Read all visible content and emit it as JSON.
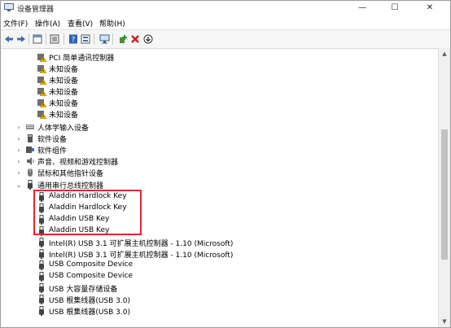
{
  "window": {
    "title": "设备管理器",
    "controls": {
      "minimize": "—",
      "maximize": "☐",
      "close": "✕"
    }
  },
  "menu": [
    "文件(F)",
    "操作(A)",
    "查看(V)",
    "帮助(H)"
  ],
  "toolbar": [
    "back-icon",
    "forward-icon",
    "properties-icon",
    "view-icon",
    "help-icon",
    "details-icon",
    "monitor-icon",
    "add-driver-icon",
    "uninstall-icon",
    "download-icon"
  ],
  "tree": {
    "unknown_group": [
      "PCI 简单通讯控制器",
      "未知设备",
      "未知设备",
      "未知设备",
      "未知设备",
      "未知设备"
    ],
    "categories": [
      "人体学输入设备",
      "软件设备",
      "软件组件",
      "声音、视频和游戏控制器",
      "鼠标和其他指针设备",
      "通用串行总线控制器"
    ],
    "usb_devices": [
      "Aladdin Hardlock Key",
      "Aladdin Hardlock Key",
      "Aladdin USB Key",
      "Aladdin USB Key",
      "Intel(R) USB 3.1 可扩展主机控制器 - 1.10 (Microsoft)",
      "Intel(R) USB 3.1 可扩展主机控制器 - 1.10 (Microsoft)",
      "USB Composite Device",
      "USB Composite Device",
      "USB 大容量存储设备",
      "USB 根集线器(USB 3.0)",
      "USB 根集线器(USB 3.0)"
    ]
  },
  "colors": {
    "highlight_border": "#e0282c",
    "warning": "#f2b600"
  }
}
